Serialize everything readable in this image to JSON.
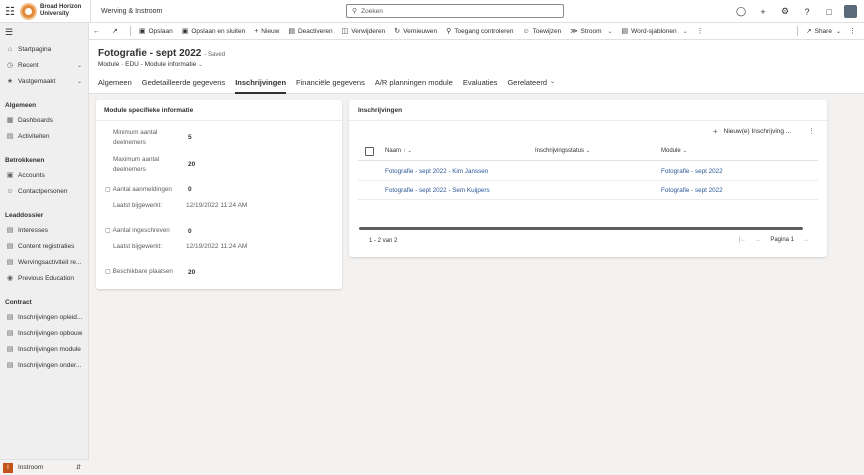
{
  "topbar": {
    "org_line1": "Broad Horizon",
    "org_line2": "University",
    "app_name": "Werving & Instroom",
    "search_placeholder": "Zoeken"
  },
  "nav": {
    "top_items": [
      {
        "label": "Startpagina",
        "icon": "home-icon"
      },
      {
        "label": "Recent",
        "icon": "clock-icon"
      },
      {
        "label": "Vastgemaakt",
        "icon": "pin-icon"
      }
    ],
    "sections": [
      {
        "title": "Algemeen",
        "items": [
          {
            "label": "Dashboards",
            "icon": "dashboard-icon"
          },
          {
            "label": "Activiteiten",
            "icon": "activity-icon"
          }
        ]
      },
      {
        "title": "Betrokkenen",
        "items": [
          {
            "label": "Accounts",
            "icon": "building-icon"
          },
          {
            "label": "Contactpersonen",
            "icon": "person-icon"
          }
        ]
      },
      {
        "title": "Leaddossier",
        "items": [
          {
            "label": "Interesses",
            "icon": "document-icon"
          },
          {
            "label": "Content registraties",
            "icon": "document-icon"
          },
          {
            "label": "Wervingsactiviteit re...",
            "icon": "document-icon"
          },
          {
            "label": "Previous Education",
            "icon": "education-icon"
          }
        ]
      },
      {
        "title": "Contract",
        "items": [
          {
            "label": "Inschrijvingen opleid...",
            "icon": "document-icon"
          },
          {
            "label": "Inschrijvingen opbouw",
            "icon": "document-icon"
          },
          {
            "label": "Inschrijvingen module",
            "icon": "document-icon"
          },
          {
            "label": "Inschrijvingen onder...",
            "icon": "document-icon"
          }
        ]
      }
    ],
    "area": {
      "badge": "I",
      "label": "Instroom"
    }
  },
  "commands": [
    {
      "label": "Opslaan",
      "icon": "save-icon"
    },
    {
      "label": "Opslaan en sluiten",
      "icon": "save-close-icon"
    },
    {
      "label": "Nieuw",
      "icon": "plus-icon"
    },
    {
      "label": "Deactiveren",
      "icon": "deactivate-icon"
    },
    {
      "label": "Verwijderen",
      "icon": "trash-icon"
    },
    {
      "label": "Vernieuwen",
      "icon": "refresh-icon"
    },
    {
      "label": "Toegang controleren",
      "icon": "access-icon"
    },
    {
      "label": "Toewijzen",
      "icon": "assign-icon"
    },
    {
      "label": "Stroom",
      "icon": "flow-icon"
    },
    {
      "label": "Word-sjablonen",
      "icon": "word-icon"
    }
  ],
  "share_label": "Share",
  "record": {
    "title": "Fotografie - sept 2022",
    "saved": "- Saved",
    "entity": "Module",
    "sep": "·",
    "form": "EDU - Module informatie"
  },
  "tabs": [
    "Algemeen",
    "Gedetailleerde gegevens",
    "Inschrijvingen",
    "Financiële gegevens",
    "A/R planningen module",
    "Evaluaties",
    "Gerelateerd"
  ],
  "module_card": {
    "title": "Module specifieke informatie",
    "min_label": "Minimum aantal deelnemers",
    "min_value": "5",
    "max_label": "Maximum aantal deelnemers",
    "max_value": "20",
    "aanmeldingen_label": "Aantal aanmeldingen",
    "aanmeldingen_value": "0",
    "updated_label_1": "Laatst bijgewerkt:",
    "updated_value_1": "12/19/2022 11:24 AM",
    "ingeschreven_label": "Aantal ingeschreven",
    "ingeschreven_value": "0",
    "updated_label_2": "Laatst bijgewerkt:",
    "updated_value_2": "12/19/2022 11:24 AM",
    "beschikbaar_label": "Beschikbare plaatsen",
    "beschikbaar_value": "20"
  },
  "inschrijvingen": {
    "title": "Inschrijvingen",
    "new_label": "Nieuw(e) Inschrijving ...",
    "columns": [
      "Naam",
      "Inschrijvingsstatus",
      "Module"
    ],
    "rows": [
      {
        "naam": "Fotografie - sept 2022 - Kim Janssen",
        "status": "",
        "module": "Fotografie - sept 2022"
      },
      {
        "naam": "Fotografie - sept 2022 - Sem Kuijpers",
        "status": "",
        "module": "Fotografie - sept 2022"
      }
    ],
    "footer": "1 - 2 van 2",
    "page_label": "Pagina 1"
  }
}
